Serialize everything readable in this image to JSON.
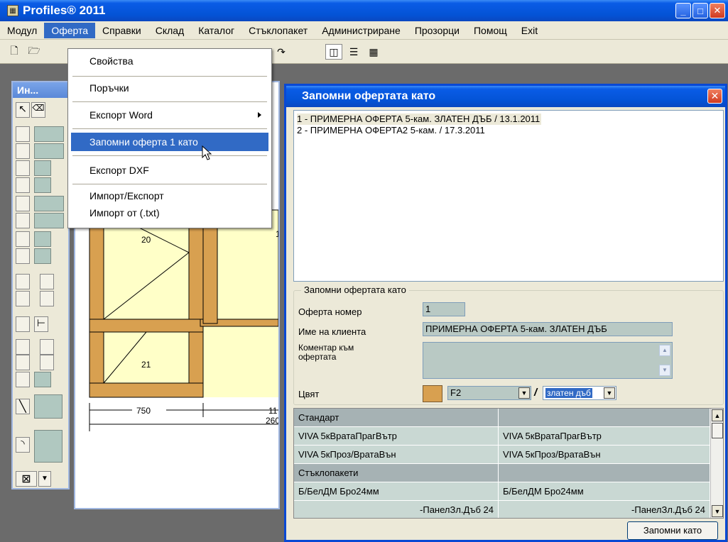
{
  "app": {
    "title": "Profiles® 2011"
  },
  "menubar": [
    "Модул",
    "Оферта",
    "Справки",
    "Склад",
    "Каталог",
    "Стъклопакет",
    "Администриране",
    "Прозорци",
    "Помощ",
    "Exit"
  ],
  "tool_window": {
    "title": "Ин..."
  },
  "drawing": {
    "labels": [
      "20",
      "21",
      "750",
      "1",
      "11",
      "260"
    ]
  },
  "dropdown": {
    "items": [
      "Свойства",
      "Поръчки",
      "Експорт Word",
      "Запомни оферта  1 като",
      "Експорт DXF",
      "Импорт/Експорт",
      "Импорт от (.txt)"
    ]
  },
  "dialog": {
    "title": "Запомни офертата като",
    "offers": [
      "1 - ПРИМЕРНА ОФЕРТА 5-кам. ЗЛАТЕН ДЪБ / 13.1.2011",
      "2 - ПРИМЕРНА ОФЕРТА2 5-кам. / 17.3.2011"
    ],
    "group_label": "Запомни офертата като",
    "offer_number_label": "Оферта номер",
    "offer_number": "1",
    "client_label": "Име на клиента",
    "client_name": "ПРИМЕРНА ОФЕРТА 5-кам. ЗЛАТЕН ДЪБ",
    "comment_label_1": "Коментар към",
    "comment_label_2": "офертата",
    "color_label": "Цвят",
    "color_code": "F2",
    "color_separator": "/",
    "color_name": "златен дъб",
    "grid": [
      [
        "Стандарт",
        ""
      ],
      [
        "VIVA 5кВратаПрагВътр",
        "VIVA 5кВратаПрагВътр"
      ],
      [
        "VIVA 5кПроз/ВратаВън",
        "VIVA 5кПроз/ВратаВън"
      ],
      [
        "Стъклопакети",
        ""
      ],
      [
        "Б/БелДМ Бро24мм",
        "Б/БелДМ Бро24мм"
      ],
      [
        "-ПанелЗл.Дъб 24",
        "-ПанелЗл.Дъб 24"
      ]
    ],
    "save_button": "Запомни като"
  }
}
